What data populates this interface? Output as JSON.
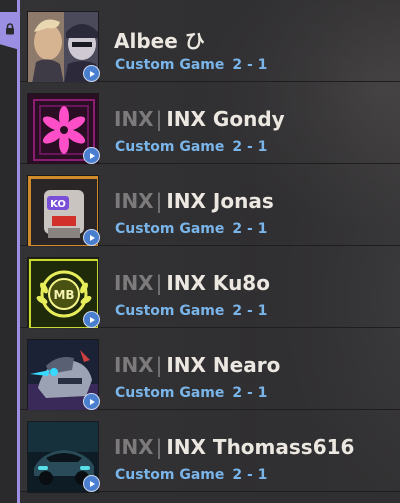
{
  "party": {
    "accent_color": "#9a8fe3",
    "lock_icon": "lock-icon"
  },
  "friends": [
    {
      "tag": "",
      "name": "Albee ひ",
      "status": "Custom Game",
      "score": "2 - 1",
      "avatar": "agent-duo-card"
    },
    {
      "tag": "INX",
      "name": "INX Gondy",
      "status": "Custom Game",
      "score": "2 - 1",
      "avatar": "neon-flower-card"
    },
    {
      "tag": "INX",
      "name": "INX Jonas",
      "status": "Custom Game",
      "score": "2 - 1",
      "avatar": "ko-robot-card"
    },
    {
      "tag": "INX",
      "name": "INX Ku8o",
      "status": "Custom Game",
      "score": "2 - 1",
      "avatar": "gold-laurel-card"
    },
    {
      "tag": "INX",
      "name": "INX Nearo",
      "status": "Custom Game",
      "score": "2 - 1",
      "avatar": "robot-dog-card"
    },
    {
      "tag": "INX",
      "name": "INX Thomass616",
      "status": "Custom Game",
      "score": "2 - 1",
      "avatar": "sports-car-card"
    }
  ],
  "colors": {
    "status_text": "#7ab5ea",
    "name_text": "#ece8e1",
    "tag_text": "#7c7a7a",
    "play_badge": "#4a7fd0"
  }
}
